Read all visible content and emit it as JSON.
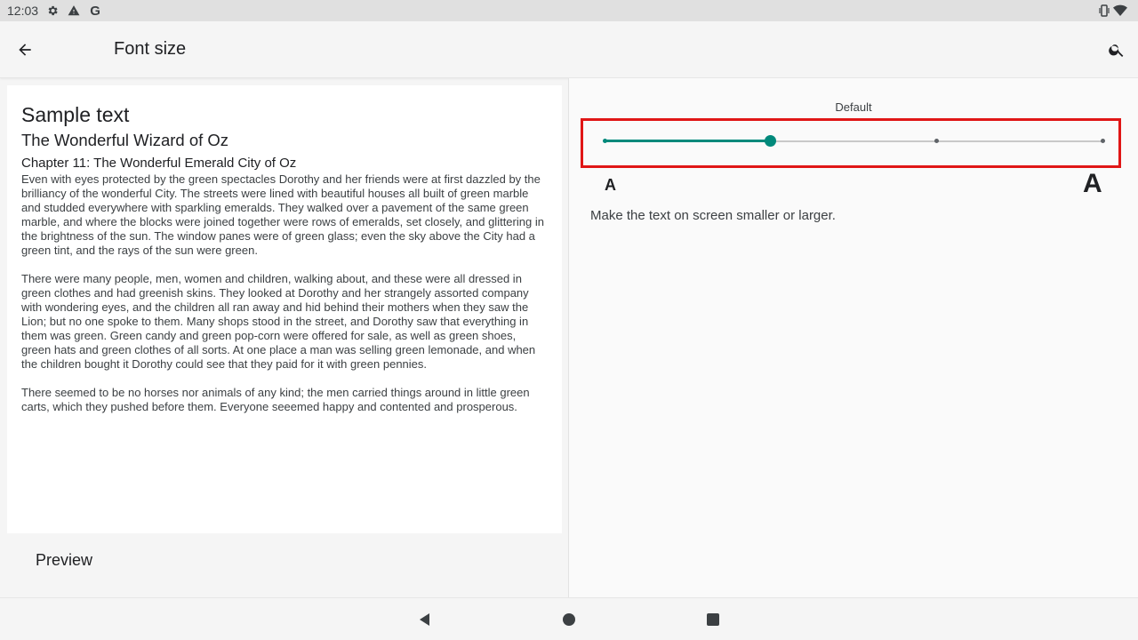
{
  "status_bar": {
    "time": "12:03",
    "icons": [
      "settings-icon",
      "warning-icon",
      "google-icon",
      "vibrate-icon",
      "wifi-icon"
    ]
  },
  "app_bar": {
    "title": "Font size",
    "back_icon": "arrow-back-icon",
    "search_icon": "search-icon"
  },
  "preview": {
    "sample_heading": "Sample text",
    "book_title": "The Wonderful Wizard of Oz",
    "chapter_title": "Chapter 11: The Wonderful Emerald City of Oz",
    "paragraphs": [
      "Even with eyes protected by the green spectacles Dorothy and her friends were at first dazzled by the brilliancy of the wonderful City. The streets were lined with beautiful houses all built of green marble and studded everywhere with sparkling emeralds. They walked over a pavement of the same green marble, and where the blocks were joined together were rows of emeralds, set closely, and glittering in the brightness of the sun. The window panes were of green glass; even the sky above the City had a green tint, and the rays of the sun were green.",
      "There were many people, men, women and children, walking about, and these were all dressed in green clothes and had greenish skins. They looked at Dorothy and her strangely assorted company with wondering eyes, and the children all ran away and hid behind their mothers when they saw the Lion; but no one spoke to them. Many shops stood in the street, and Dorothy saw that everything in them was green. Green candy and green pop-corn were offered for sale, as well as green shoes, green hats and green clothes of all sorts. At one place a man was selling green lemonade, and when the children bought it Dorothy could see that they paid for it with green pennies.",
      "There seemed to be no horses nor animals of any kind; the men carried things around in little green carts, which they pushed before them. Everyone seeemed happy and contented and prosperous."
    ],
    "label": "Preview"
  },
  "font_size_setting": {
    "current_label": "Default",
    "steps": 4,
    "current_index": 1,
    "small_label": "A",
    "large_label": "A",
    "summary": "Make the text on screen smaller or larger.",
    "accent_color": "#00897b",
    "highlight_color": "#e01616"
  },
  "nav_bar": {
    "icons": [
      "back-triangle-icon",
      "home-circle-icon",
      "recents-square-icon"
    ]
  }
}
